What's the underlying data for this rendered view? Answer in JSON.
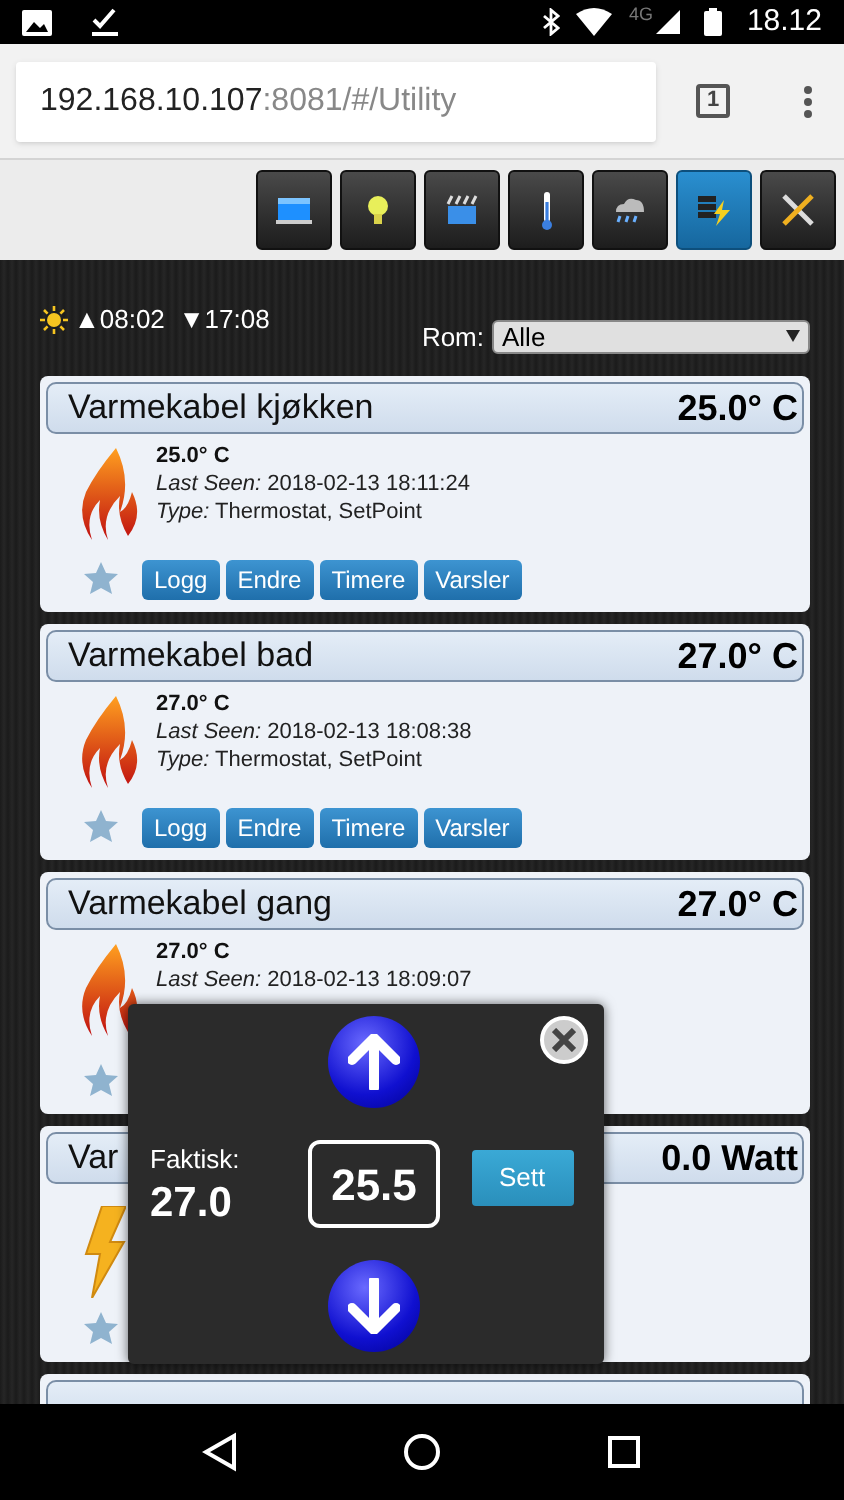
{
  "status_bar": {
    "network": "4G",
    "time": "18.12"
  },
  "browser": {
    "url_host": "192.168.10.107",
    "url_rest": ":8081/#/Utility",
    "tab_count": "1"
  },
  "toolbar": [
    {
      "kind": "screen",
      "selected": false
    },
    {
      "kind": "bulb",
      "selected": false
    },
    {
      "kind": "scene",
      "selected": false
    },
    {
      "kind": "thermometer",
      "selected": false
    },
    {
      "kind": "weather",
      "selected": false
    },
    {
      "kind": "utility",
      "selected": true
    },
    {
      "kind": "tools",
      "selected": false
    }
  ],
  "sun": {
    "sunrise": "▲08:02",
    "sunset": "▼17:08"
  },
  "room_filter": {
    "label": "Rom:",
    "value": "Alle"
  },
  "devices": [
    {
      "name": "Varmekabel kjøkken",
      "reading": "25.0° C",
      "kind": "heat",
      "status": "25.0° C",
      "last_seen_label": "Last Seen:",
      "last_seen": "2018-02-13 18:11:24",
      "type_label": "Type:",
      "type": "Thermostat, SetPoint",
      "buttons": [
        "Logg",
        "Endre",
        "Timere",
        "Varsler"
      ]
    },
    {
      "name": "Varmekabel bad",
      "reading": "27.0° C",
      "kind": "heat",
      "status": "27.0° C",
      "last_seen_label": "Last Seen:",
      "last_seen": "2018-02-13 18:08:38",
      "type_label": "Type:",
      "type": "Thermostat, SetPoint",
      "buttons": [
        "Logg",
        "Endre",
        "Timere",
        "Varsler"
      ]
    },
    {
      "name": "Varmekabel gang",
      "reading": "27.0° C",
      "kind": "heat",
      "status": "27.0° C",
      "last_seen_label": "Last Seen:",
      "last_seen": "2018-02-13 18:09:07"
    },
    {
      "name": "Var",
      "reading": "0.0 Watt",
      "kind": "power"
    }
  ],
  "list_continues": true,
  "setpoint_dialog": {
    "actual_label": "Faktisk:",
    "actual": "27.0",
    "setpoint": "25.5",
    "button": "Sett"
  }
}
